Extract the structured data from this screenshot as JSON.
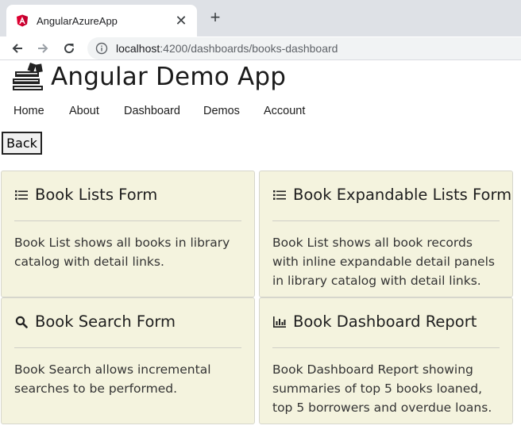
{
  "browser": {
    "tab_title": "AngularAzureApp",
    "new_tab_symbol": "+",
    "url_host": "localhost",
    "url_rest": ":4200/dashboards/books-dashboard"
  },
  "app": {
    "title": "Angular Demo App",
    "logo_icon": "books-icon"
  },
  "nav": [
    "Home",
    "About",
    "Dashboard",
    "Demos",
    "Account"
  ],
  "back_label": "Back",
  "cards": [
    {
      "icon": "list-icon",
      "title": "Book Lists Form",
      "body": "Book List shows all books in library catalog with detail links."
    },
    {
      "icon": "list-icon",
      "title": "Book Expandable Lists Form",
      "body": "Book List shows all book records with inline expandable detail panels in library catalog with detail links."
    },
    {
      "icon": "search-icon",
      "title": "Book Search Form",
      "body": "Book Search allows incremental searches to be performed."
    },
    {
      "icon": "bar-chart-icon",
      "title": "Book Dashboard Report",
      "body": "Book Dashboard Report showing summaries of top 5 books loaned, top 5 borrowers and overdue loans."
    }
  ],
  "colors": {
    "card_bg": "#f4f3de",
    "angular_red": "#dd0031",
    "chrome_tabstrip": "#dee1e6"
  }
}
